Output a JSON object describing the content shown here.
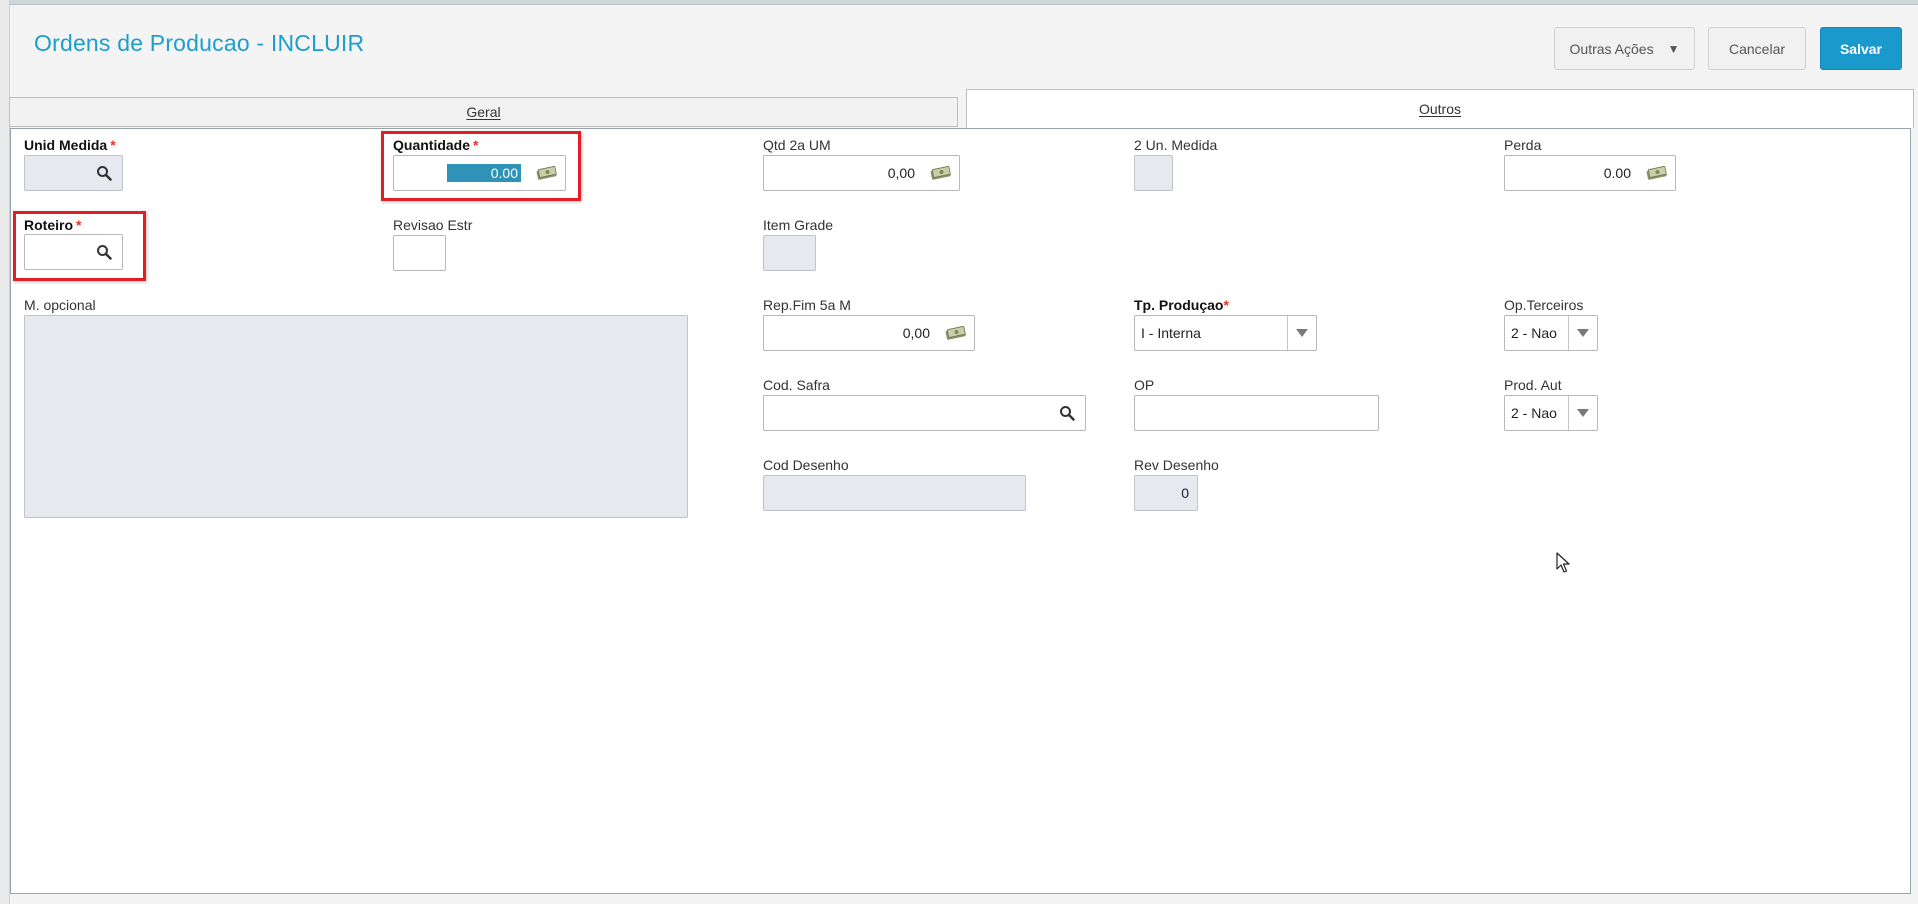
{
  "page_title": "Ordens de Producao - INCLUIR",
  "actions": {
    "more_label": "Outras Ações",
    "cancel_label": "Cancelar",
    "save_label": "Salvar"
  },
  "tabs": [
    {
      "label": "Geral",
      "active": false
    },
    {
      "label": "Outros",
      "active": true
    }
  ],
  "fields": {
    "unid_medida": {
      "label": "Unid Medida",
      "required_mark": "*",
      "value": ""
    },
    "quantidade": {
      "label": "Quantidade",
      "required_mark": "*",
      "value": "0.00"
    },
    "qtd_2a_um": {
      "label": "Qtd 2a UM",
      "value": "0,00"
    },
    "un_medida_2": {
      "label": "2 Un. Medida",
      "value": ""
    },
    "perda": {
      "label": "Perda",
      "value": "0.00"
    },
    "roteiro": {
      "label": "Roteiro",
      "required_mark": "*",
      "value": ""
    },
    "revisao_estr": {
      "label": "Revisao Estr",
      "value": ""
    },
    "item_grade": {
      "label": "Item Grade",
      "value": ""
    },
    "m_opcional": {
      "label": "M. opcional",
      "value": ""
    },
    "rep_fim": {
      "label": "Rep.Fim 5a M",
      "value": "0,00"
    },
    "tp_producao": {
      "label": "Tp. Produçao",
      "required_mark": "*",
      "value": "I - Interna"
    },
    "op_terceiros": {
      "label": "Op.Terceiros",
      "value": "2 - Nao"
    },
    "cod_safra": {
      "label": "Cod. Safra",
      "value": ""
    },
    "op": {
      "label": "OP",
      "value": ""
    },
    "prod_aut": {
      "label": "Prod. Aut",
      "value": "2 - Nao"
    },
    "cod_desenho": {
      "label": "Cod Desenho",
      "value": ""
    },
    "rev_desenho": {
      "label": "Rev Desenho",
      "value": "0"
    }
  },
  "colors": {
    "accent": "#1e9ecb",
    "primary_button": "#1a99cc",
    "highlight_box": "#e21d26",
    "required": "#e4322b"
  },
  "icons": [
    "search-icon",
    "money-calculator-icon",
    "chevron-down-icon",
    "mouse-cursor-icon"
  ]
}
